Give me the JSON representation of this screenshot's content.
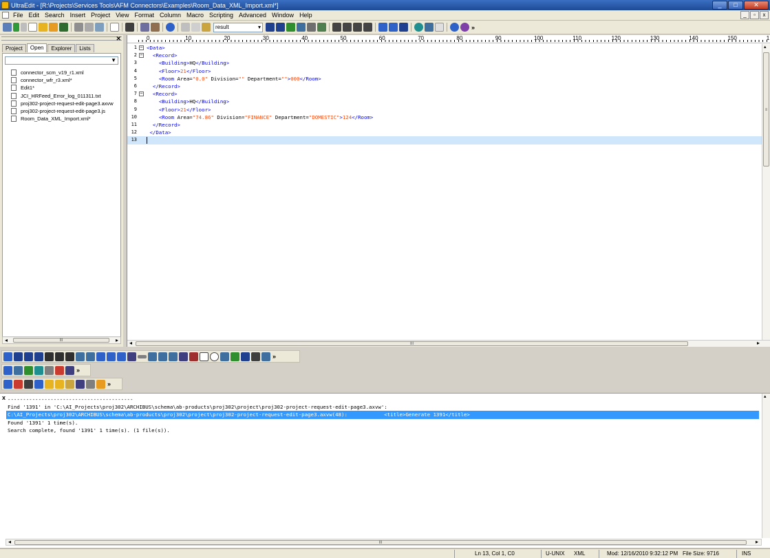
{
  "window": {
    "title": "UltraEdit - [R:\\Projects\\Services Tools\\AFM Connectors\\Examples\\Room_Data_XML_Import.xml*]",
    "controls": {
      "minimize": "_",
      "maximize": "□",
      "close": "✕"
    }
  },
  "menu": [
    "File",
    "Edit",
    "Search",
    "Insert",
    "Project",
    "View",
    "Format",
    "Column",
    "Macro",
    "Scripting",
    "Advanced",
    "Window",
    "Help"
  ],
  "mdi_controls": {
    "minimize": "_",
    "restore": "▫",
    "close": "x"
  },
  "toolbar": {
    "find_value": "result",
    "more": "»",
    "colors": {
      "blue": "#2f62c9",
      "green": "#2f9a3a",
      "yellow": "#e8b321",
      "red": "#c93a2f",
      "gray": "#8f8f8f",
      "navy": "#1f3f8f",
      "teal": "#1f8f8f",
      "purple": "#7f3fa9"
    }
  },
  "left_panel": {
    "close": "✕",
    "tabs": [
      "Project",
      "Open",
      "Explorer",
      "Lists"
    ],
    "active_tab": "Open",
    "combo_arrow": "▼",
    "files": [
      "connector_scm_v19_r1.xml",
      "connector_wfr_r3.xml*",
      "Edit1*",
      "JCI_HRFeed_Error_log_011311.txt",
      "proj302-project-request-edit-page3.axvw",
      "proj302-project-request-edit-page3.js",
      "Room_Data_XML_Import.xml*"
    ],
    "scroll_left": "◂",
    "scroll_right": "▸",
    "scroll_grip": "III"
  },
  "ruler": {
    "labels": [
      "0",
      "10",
      "20",
      "30",
      "40",
      "50",
      "60",
      "70",
      "80",
      "90",
      "100",
      "110",
      "120",
      "130",
      "140",
      "150",
      "1"
    ]
  },
  "editor": {
    "lines": [
      {
        "n": "1",
        "fold": "−",
        "parts": [
          [
            "tg",
            "<Data>"
          ]
        ]
      },
      {
        "n": "2",
        "fold": "−",
        "parts": [
          [
            "tx",
            "  "
          ],
          [
            "tg",
            "<Record>"
          ]
        ]
      },
      {
        "n": "3",
        "fold": "",
        "parts": [
          [
            "tx",
            "    "
          ],
          [
            "tg",
            "<Building>"
          ],
          [
            "tx",
            "HQ"
          ],
          [
            "tg",
            "</Building>"
          ]
        ]
      },
      {
        "n": "4",
        "fold": "",
        "parts": [
          [
            "tx",
            "    "
          ],
          [
            "tg",
            "<Floor>"
          ],
          [
            "av",
            "21"
          ],
          [
            "tg",
            "</Floor>"
          ]
        ]
      },
      {
        "n": "5",
        "fold": "",
        "parts": [
          [
            "tx",
            "    "
          ],
          [
            "tg",
            "<Room"
          ],
          [
            "at",
            " Area="
          ],
          [
            "av",
            "\"0.0\""
          ],
          [
            "at",
            " Division="
          ],
          [
            "av",
            "\"\""
          ],
          [
            "at",
            " Department="
          ],
          [
            "av",
            "\"\""
          ],
          [
            "tg",
            ">"
          ],
          [
            "av",
            "000"
          ],
          [
            "tg",
            "</Room>"
          ]
        ]
      },
      {
        "n": "6",
        "fold": "",
        "parts": [
          [
            "tx",
            "  "
          ],
          [
            "tg",
            "</Record>"
          ]
        ]
      },
      {
        "n": "7",
        "fold": "−",
        "parts": [
          [
            "tx",
            "  "
          ],
          [
            "tg",
            "<Record>"
          ]
        ]
      },
      {
        "n": "8",
        "fold": "",
        "parts": [
          [
            "tx",
            "    "
          ],
          [
            "tg",
            "<Building>"
          ],
          [
            "tx",
            "HQ"
          ],
          [
            "tg",
            "</Building>"
          ]
        ]
      },
      {
        "n": "9",
        "fold": "",
        "parts": [
          [
            "tx",
            "    "
          ],
          [
            "tg",
            "<Floor>"
          ],
          [
            "av",
            "21"
          ],
          [
            "tg",
            "</Floor>"
          ]
        ]
      },
      {
        "n": "10",
        "fold": "",
        "parts": [
          [
            "tx",
            "    "
          ],
          [
            "tg",
            "<Room"
          ],
          [
            "at",
            " Area="
          ],
          [
            "av",
            "\"74.86\""
          ],
          [
            "at",
            " Division="
          ],
          [
            "av",
            "\"FINANCE\""
          ],
          [
            "at",
            " Department="
          ],
          [
            "av",
            "\"DOMESTIC\""
          ],
          [
            "tg",
            ">"
          ],
          [
            "av",
            "124"
          ],
          [
            "tg",
            "</Room>"
          ]
        ]
      },
      {
        "n": "11",
        "fold": "",
        "parts": [
          [
            "tx",
            "  "
          ],
          [
            "tg",
            "</Record>"
          ]
        ]
      },
      {
        "n": "12",
        "fold": "",
        "parts": [
          [
            "tx",
            " "
          ],
          [
            "tg",
            "</Data>"
          ]
        ]
      },
      {
        "n": "13",
        "fold": "",
        "parts": []
      }
    ],
    "scroll_left": "◂",
    "scroll_right": "▸",
    "scroll_grip": "III",
    "vscroll_grip": "≡"
  },
  "output": {
    "close": "x",
    "lines": [
      "-----------------------------------------",
      "Find '1391' in 'C:\\AI_Projects\\proj302\\ARCHIBUS\\schema\\ab-products\\proj302\\project\\proj302-project-request-edit-page3.axvw':",
      "C:\\AI_Projects\\proj302\\ARCHIBUS\\schema\\ab-products\\proj302\\project\\proj302-project-request-edit-page3.axvw(48):            <title>Generate 1391</title>",
      "Found '1391' 1 time(s).",
      "Search complete, found '1391' 1 time(s). (1 file(s))."
    ],
    "highlight_index": 2,
    "scroll_grip": "III",
    "scroll_left": "◂",
    "scroll_right": "▸"
  },
  "status": {
    "position": "Ln 13, Col 1, C0",
    "line_ending": "U-UNIX",
    "syntax": "XML",
    "modified": "Mod: 12/16/2010 9:32:12 PM",
    "file_size": "File Size: 9716",
    "mode": "INS"
  }
}
